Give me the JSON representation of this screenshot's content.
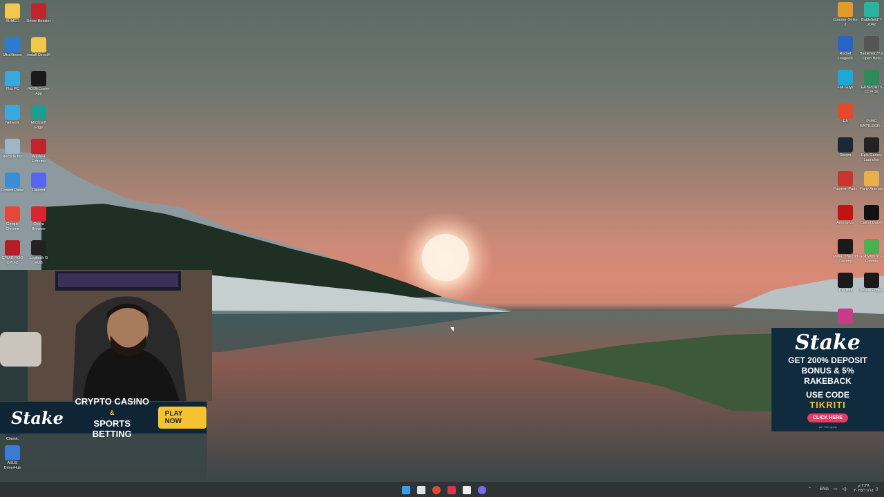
{
  "left_icons": [
    {
      "label": "AHMED",
      "icon": "folder-icon",
      "color": "#f2c94c"
    },
    {
      "label": "Driver Booster",
      "icon": "driver-booster-icon",
      "color": "#c0242c"
    },
    {
      "label": "UltraViewer",
      "icon": "ultraviewer-icon",
      "color": "#2a7bd4"
    },
    {
      "label": "Install DirectX",
      "icon": "folder-icon",
      "color": "#f2c94c"
    },
    {
      "label": "This PC",
      "icon": "monitor-icon",
      "color": "#3aa8e0"
    },
    {
      "label": "RODECaster App",
      "icon": "rodecaster-icon",
      "color": "#1a1a1a"
    },
    {
      "label": "Network",
      "icon": "network-icon",
      "color": "#3aa8e0"
    },
    {
      "label": "Microsoft Edge",
      "icon": "edge-icon",
      "color": "#1f9e8f"
    },
    {
      "label": "Recycle Bin",
      "icon": "recycle-bin-icon",
      "color": "#9fb6c8"
    },
    {
      "label": "AIDA64 Extreme",
      "icon": "aida64-icon",
      "color": "#c0242c"
    },
    {
      "label": "Control Panel",
      "icon": "control-panel-icon",
      "color": "#3a8fd4"
    },
    {
      "label": "Discord",
      "icon": "discord-icon",
      "color": "#5865f2"
    },
    {
      "label": "Google Chrome",
      "icon": "chrome-icon",
      "color": "#e9463a"
    },
    {
      "label": "Opera Browser",
      "icon": "opera-icon",
      "color": "#d7262d"
    },
    {
      "label": "CPUID ROG CPU-Z",
      "icon": "cpuz-icon",
      "color": "#b21f24"
    },
    {
      "label": "Logitech G HUB",
      "icon": "logitech-ghub-icon",
      "color": "#222222"
    }
  ],
  "left_bottom_icons": [
    {
      "label": "Classic",
      "icon": "app-icon",
      "color": "#335"
    },
    {
      "label": "ASUS DriverHub",
      "icon": "asus-driverhub-icon",
      "color": "#3a7bd5"
    }
  ],
  "right_icons": [
    {
      "label": "Counter-Strike 2",
      "icon": "cs2-icon",
      "color": "#e39a2b"
    },
    {
      "label": "Battlefield™ 2042",
      "icon": "battlefield-2042-icon",
      "color": "#2bb3a0"
    },
    {
      "label": "Rocket League®",
      "icon": "rocket-league-icon",
      "color": "#2764c4"
    },
    {
      "label": "Battlefield™ 6 Open Beta",
      "icon": "battlefield-6-icon",
      "color": "#555555"
    },
    {
      "label": "Fall Guys",
      "icon": "fall-guys-icon",
      "color": "#1ea8d8"
    },
    {
      "label": "EA SPORTS FC™ 25",
      "icon": "ea-fc25-icon",
      "color": "#2e8b57"
    },
    {
      "label": "EA",
      "icon": "ea-icon",
      "color": "#e24a2b"
    },
    {
      "label": "PUBG BATTLEGR...",
      "icon": "pubg-icon",
      "color": "#777777"
    },
    {
      "label": "Steam",
      "icon": "steam-icon",
      "color": "#1b2838"
    },
    {
      "label": "Epic Games Launcher",
      "icon": "epic-games-icon",
      "color": "#222222"
    },
    {
      "label": "Pummel Party",
      "icon": "pummel-party-icon",
      "color": "#c9342f"
    },
    {
      "label": "Party Animals",
      "icon": "party-animals-icon",
      "color": "#e8b04a"
    },
    {
      "label": "Among Us",
      "icon": "among-us-icon",
      "color": "#c51111"
    },
    {
      "label": "Call of Duty®",
      "icon": "call-of-duty-icon",
      "color": "#111111"
    },
    {
      "label": "Mafia: The Old Country",
      "icon": "mafia-icon",
      "color": "#1a1a1a"
    },
    {
      "label": "Golf With Your Friends",
      "icon": "golf-icon",
      "color": "#4caf50"
    },
    {
      "label": "The Bus",
      "icon": "the-bus-icon",
      "color": "#1a1a1a"
    },
    {
      "label": "Unreal Engine",
      "icon": "unreal-engine-icon",
      "color": "#1a1a1a"
    },
    {
      "label": "",
      "icon": "app-icon",
      "color": "#c83a8c"
    }
  ],
  "banner": {
    "logo": "Stake",
    "line1": "CRYPTO CASINO",
    "amp": "&",
    "line2": "SPORTS BETTING",
    "button": "PLAY NOW"
  },
  "ad": {
    "logo": "Stake",
    "line1": "GET 200% DEPOSIT",
    "line2": "BONUS & 5%",
    "line3": "RAKEBACK",
    "use_code": "USE CODE",
    "code": "TIKRITI",
    "button": "CLICK HERE",
    "fine": "18+ T&C apply"
  },
  "taskbar": {
    "apps": [
      {
        "icon": "windows-start-icon",
        "color": "#3aa0f0"
      },
      {
        "icon": "task-view-icon",
        "color": "#dfe4e6"
      },
      {
        "icon": "chrome-icon",
        "color": "#e9463a"
      },
      {
        "icon": "app-icon",
        "color": "#d9364c"
      },
      {
        "icon": "rodecaster-icon",
        "color": "#eeeeee"
      },
      {
        "icon": "discord-icon",
        "color": "#7b6cf2"
      }
    ],
    "lang": "ENG",
    "clock_time": "٢:٣٨ م",
    "clock_date": "٢٠٢٥/١١/١٤"
  }
}
